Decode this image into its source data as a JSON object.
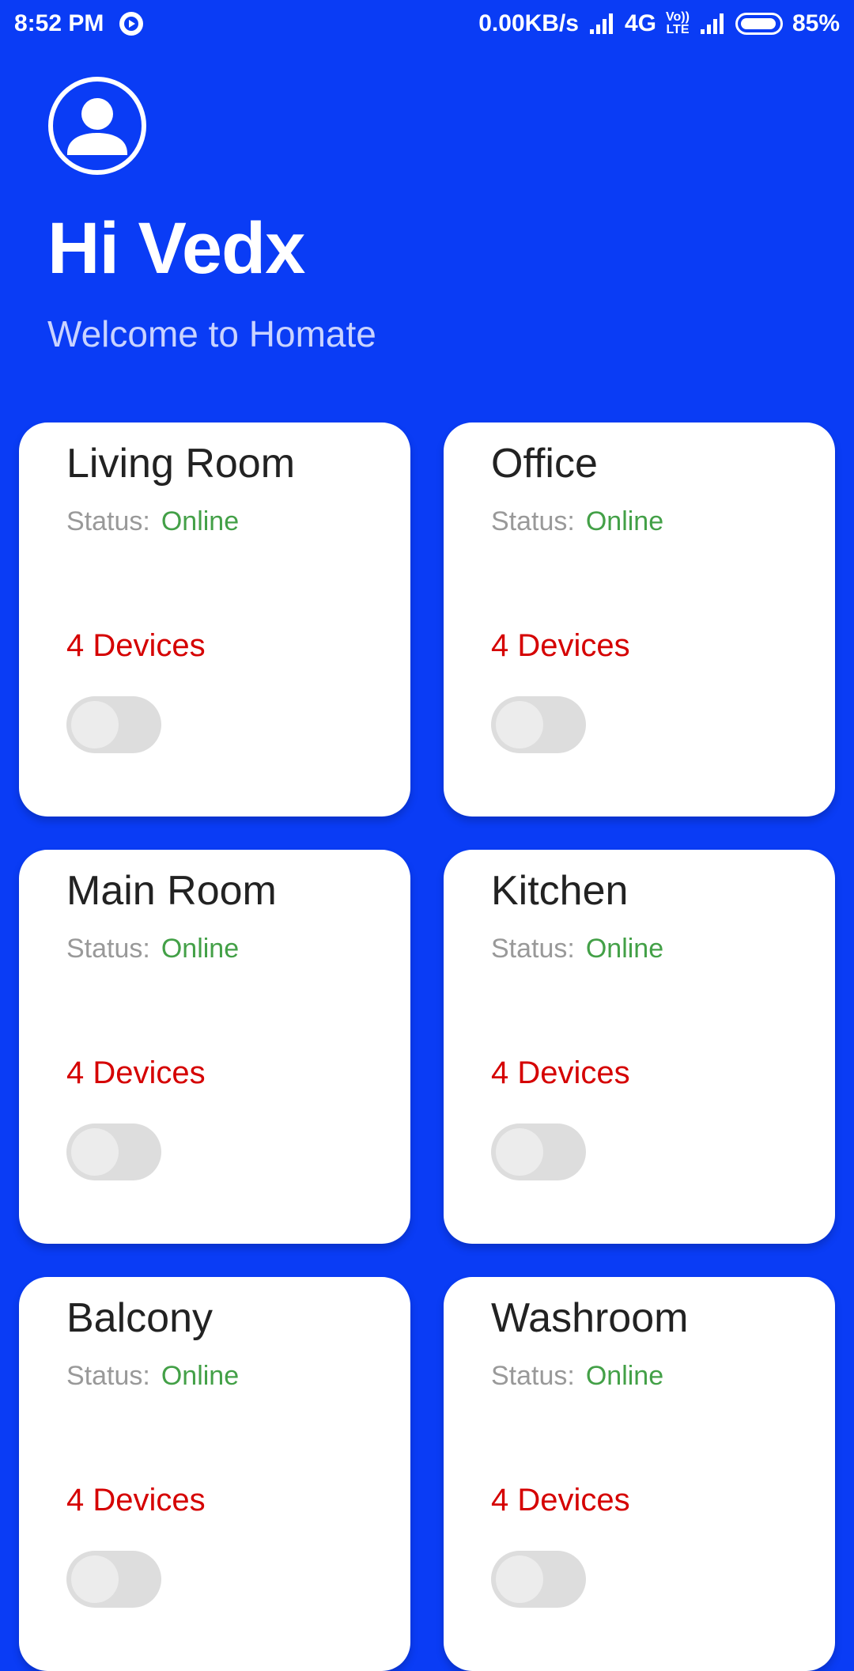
{
  "status_bar": {
    "time": "8:52 PM",
    "speed": "0.00KB/s",
    "network": "4G",
    "volte_top": "Vo))",
    "volte_bottom": "LTE",
    "battery": "85%"
  },
  "header": {
    "greeting": "Hi Vedx",
    "subtitle": "Welcome to Homate"
  },
  "rooms": [
    {
      "name": "Living Room",
      "status_label": "Status:",
      "status": "Online",
      "devices": "4 Devices",
      "on": false
    },
    {
      "name": "Office",
      "status_label": "Status:",
      "status": "Online",
      "devices": "4 Devices",
      "on": false
    },
    {
      "name": "Main Room",
      "status_label": "Status:",
      "status": "Online",
      "devices": "4 Devices",
      "on": false
    },
    {
      "name": "Kitchen",
      "status_label": "Status:",
      "status": "Online",
      "devices": "4 Devices",
      "on": false
    },
    {
      "name": "Balcony",
      "status_label": "Status:",
      "status": "Online",
      "devices": "4 Devices",
      "on": false
    },
    {
      "name": "Washroom",
      "status_label": "Status:",
      "status": "Online",
      "devices": "4 Devices",
      "on": false
    }
  ],
  "colors": {
    "background": "#0a3cf5",
    "online": "#43a047",
    "devices": "#d50000"
  },
  "icons": {
    "avatar": "account-circle-icon",
    "play": "play-circle-icon"
  }
}
